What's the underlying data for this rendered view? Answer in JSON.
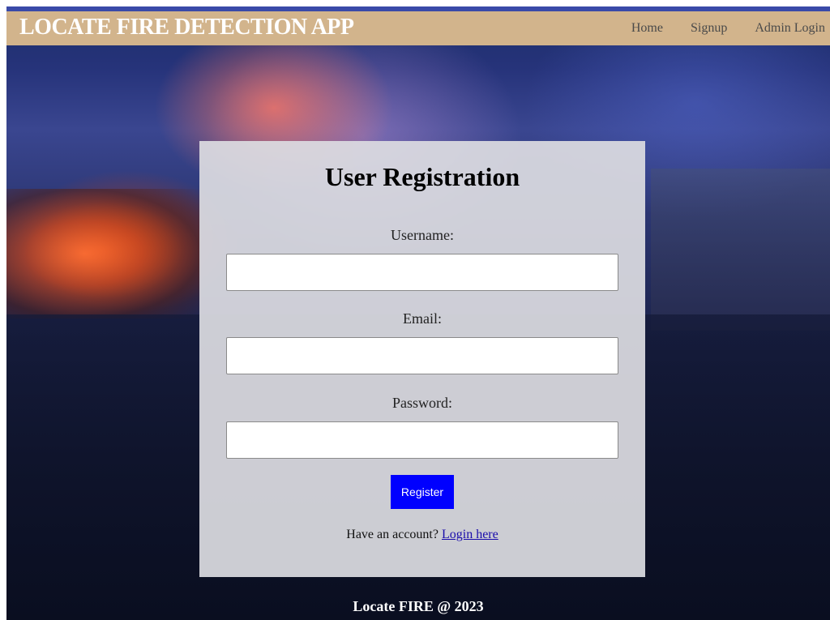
{
  "header": {
    "brand": "LOCATE FIRE DETECTION APP",
    "nav": [
      {
        "label": "Home"
      },
      {
        "label": "Signup"
      },
      {
        "label": "Admin Login"
      }
    ]
  },
  "form": {
    "title": "User Registration",
    "fields": [
      {
        "label": "Username:",
        "value": "",
        "placeholder": ""
      },
      {
        "label": "Email:",
        "value": "",
        "placeholder": ""
      },
      {
        "label": "Password:",
        "value": "",
        "placeholder": ""
      }
    ],
    "submit_label": "Register",
    "account_prompt": "Have an account?",
    "login_link": "Login here"
  },
  "footer": {
    "text": "Locate FIRE @ 2023"
  },
  "colors": {
    "header_bg": "#d2b48c",
    "header_accent": "#3a4aa8",
    "button_bg": "#0000ff",
    "link": "#1a0dab"
  }
}
